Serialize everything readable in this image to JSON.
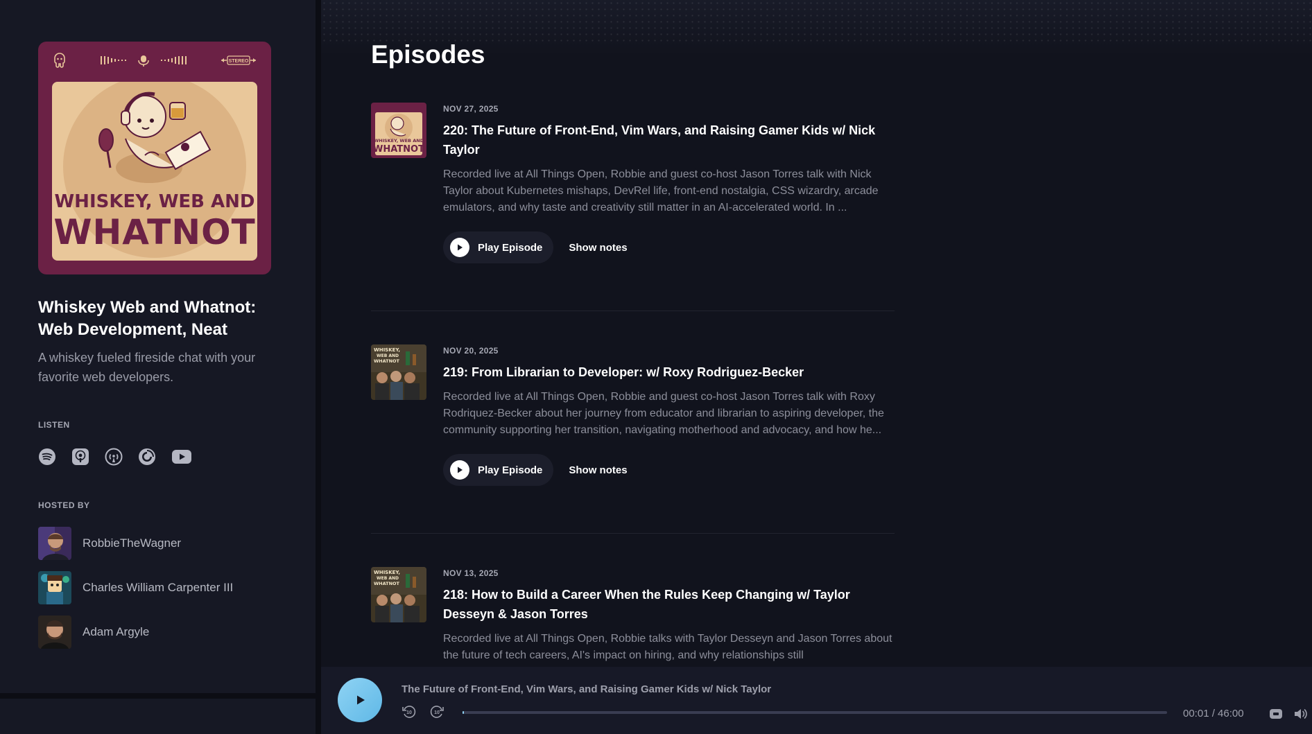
{
  "podcast": {
    "cover_top_label": "STEREO",
    "cover_line1": "WHISKEY, WEB AND",
    "cover_line2": "WHATNOT",
    "title": "Whiskey Web and Whatnot: Web Development, Neat",
    "description": "A whiskey fueled fireside chat with your favorite web developers."
  },
  "listen": {
    "label": "LISTEN",
    "icons": [
      "spotify-icon",
      "apple-podcasts-icon",
      "overcast-icon",
      "pocket-casts-icon",
      "youtube-icon"
    ]
  },
  "hosts": {
    "label": "HOSTED BY",
    "items": [
      {
        "name": "RobbieTheWagner"
      },
      {
        "name": "Charles William Carpenter III"
      },
      {
        "name": "Adam Argyle"
      }
    ]
  },
  "main": {
    "title": "Episodes",
    "play_label": "Play Episode",
    "notes_label": "Show notes",
    "episodes": [
      {
        "date": "NOV 27, 2025",
        "title": "220: The Future of Front-End, Vim Wars, and Raising Gamer Kids w/ Nick Taylor",
        "description": "Recorded live at All Things Open, Robbie and guest co-host Jason Torres talk with Nick Taylor about Kubernetes mishaps, DevRel life, front-end nostalgia, CSS wizardry, arcade emulators, and why taste and creativity still matter in an AI-accelerated world. In ..."
      },
      {
        "date": "NOV 20, 2025",
        "title": "219: From Librarian to Developer: w/ Roxy Rodriguez-Becker",
        "description": "Recorded live at All Things Open, Robbie and guest co-host Jason Torres talk with Roxy Rodriquez-Becker about her journey from educator and librarian to aspiring developer, the community supporting her transition, navigating motherhood and advocacy, and how he..."
      },
      {
        "date": "NOV 13, 2025",
        "title": "218: How to Build a Career When the Rules Keep Changing w/ Taylor Desseyn & Jason Torres",
        "description": "Recorded live at All Things Open, Robbie talks with Taylor Desseyn and Jason Torres about the future of tech careers, AI's impact on hiring, and why relationships still"
      }
    ]
  },
  "player": {
    "title": "The Future of Front-End, Vim Wars, and Raising Gamer Kids w/ Nick Taylor",
    "time": "00:01 / 46:00",
    "rewind_label": "10",
    "forward_label": "10",
    "progress": 0.0004
  },
  "colors": {
    "accent": "#8fd3f4",
    "cover_bg": "#6b2145",
    "cover_inner": "#e9c79a",
    "background": "#11131d"
  }
}
